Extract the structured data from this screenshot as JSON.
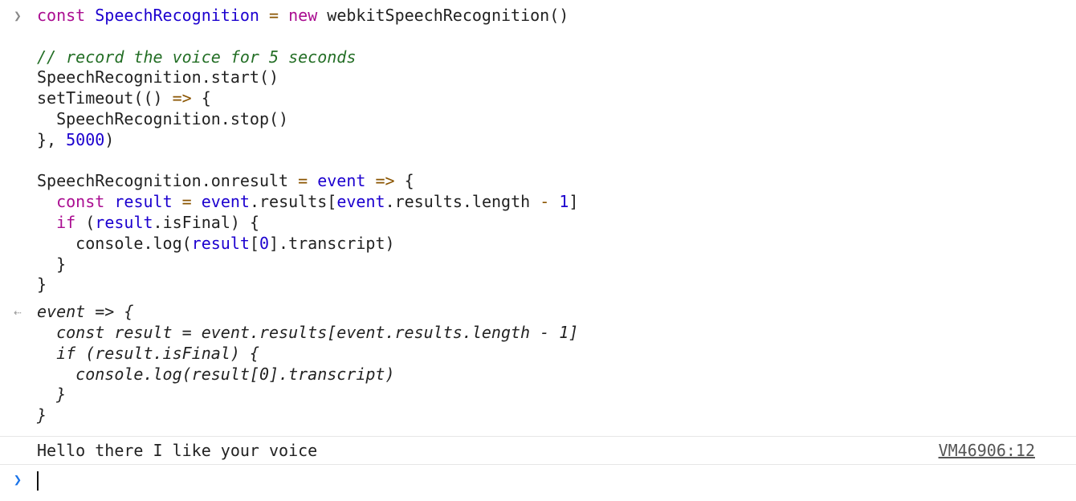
{
  "console": {
    "input_prompt_icon": "chevron-right-icon",
    "result_icon": "return-arrow-icon",
    "active_prompt_icon": "chevron-right-icon",
    "input_code": [
      [
        [
          "kw",
          "const"
        ],
        [
          "pl",
          " "
        ],
        [
          "var",
          "SpeechRecognition"
        ],
        [
          "pl",
          " "
        ],
        [
          "op",
          "="
        ],
        [
          "pl",
          " "
        ],
        [
          "kw",
          "new"
        ],
        [
          "pl",
          " webkitSpeechRecognition()"
        ]
      ],
      [],
      [
        [
          "cm",
          "// record the voice for 5 seconds"
        ]
      ],
      [
        [
          "pl",
          "SpeechRecognition.start()"
        ]
      ],
      [
        [
          "pl",
          "setTimeout(() "
        ],
        [
          "op",
          "=>"
        ],
        [
          "pl",
          " {"
        ]
      ],
      [
        [
          "pl",
          "  SpeechRecognition.stop()"
        ]
      ],
      [
        [
          "pl",
          "}, "
        ],
        [
          "num",
          "5000"
        ],
        [
          "pl",
          ")"
        ]
      ],
      [],
      [
        [
          "pl",
          "SpeechRecognition.onresult "
        ],
        [
          "op",
          "="
        ],
        [
          "pl",
          " "
        ],
        [
          "var",
          "event"
        ],
        [
          "pl",
          " "
        ],
        [
          "op",
          "=>"
        ],
        [
          "pl",
          " {"
        ]
      ],
      [
        [
          "pl",
          "  "
        ],
        [
          "kw",
          "const"
        ],
        [
          "pl",
          " "
        ],
        [
          "var",
          "result"
        ],
        [
          "pl",
          " "
        ],
        [
          "op",
          "="
        ],
        [
          "pl",
          " "
        ],
        [
          "var",
          "event"
        ],
        [
          "pl",
          ".results["
        ],
        [
          "var",
          "event"
        ],
        [
          "pl",
          ".results.length "
        ],
        [
          "op",
          "-"
        ],
        [
          "pl",
          " "
        ],
        [
          "num",
          "1"
        ],
        [
          "pl",
          "]"
        ]
      ],
      [
        [
          "pl",
          "  "
        ],
        [
          "kw",
          "if"
        ],
        [
          "pl",
          " ("
        ],
        [
          "var",
          "result"
        ],
        [
          "pl",
          ".isFinal) {"
        ]
      ],
      [
        [
          "pl",
          "    console.log("
        ],
        [
          "var",
          "result"
        ],
        [
          "pl",
          "["
        ],
        [
          "num",
          "0"
        ],
        [
          "pl",
          "].transcript)"
        ]
      ],
      [
        [
          "pl",
          "  }"
        ]
      ],
      [
        [
          "pl",
          "}"
        ]
      ]
    ],
    "result_code": [
      "event => {",
      "  const result = event.results[event.results.length - 1]",
      "  if (result.isFinal) {",
      "    console.log(result[0].transcript)",
      "  }",
      "}"
    ],
    "log": {
      "message": "Hello there I like your voice",
      "source": "VM46906:12"
    }
  }
}
